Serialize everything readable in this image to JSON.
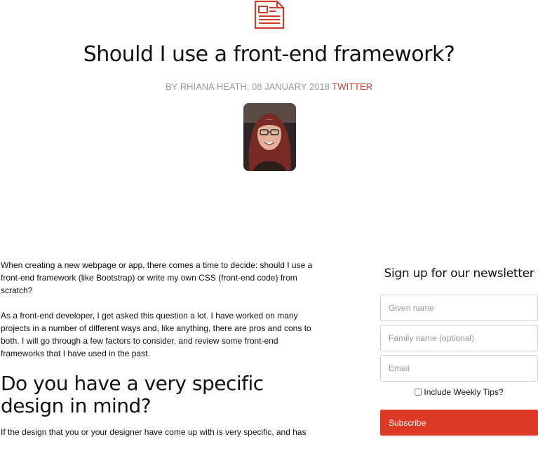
{
  "article": {
    "title": "Should I use a front-end framework?",
    "byline_prefix": "BY RHIANA HEATH, 08 JANUARY 2018",
    "twitter_link": "TWITTER",
    "paragraphs": [
      "When creating a new webpage or app, there comes a time to decide: should I use a front-end framework (like Bootstrap) or write my own CSS (front-end code) from scratch?",
      "As a front-end developer, I get asked this question a lot. I have worked on many projects in a number of different ways and, like anything, there are pros and cons to both. I will go through a few factors to consider, and review some front-end frameworks that I have used in the past."
    ],
    "heading": "Do you have a very specific design in mind?",
    "trailing_paragraph": "If the design that you or your designer have come up with is very specific, and has"
  },
  "newsletter": {
    "title": "Sign up for our newsletter",
    "given_name_placeholder": "Given name",
    "family_name_placeholder": "Family name (optional)",
    "email_placeholder": "Email",
    "checkbox_label": "Include Weekly Tips?",
    "subscribe_label": "Subscribe"
  },
  "icons": {
    "article": "newspaper-icon"
  },
  "colors": {
    "accent": "#dc3a26"
  }
}
